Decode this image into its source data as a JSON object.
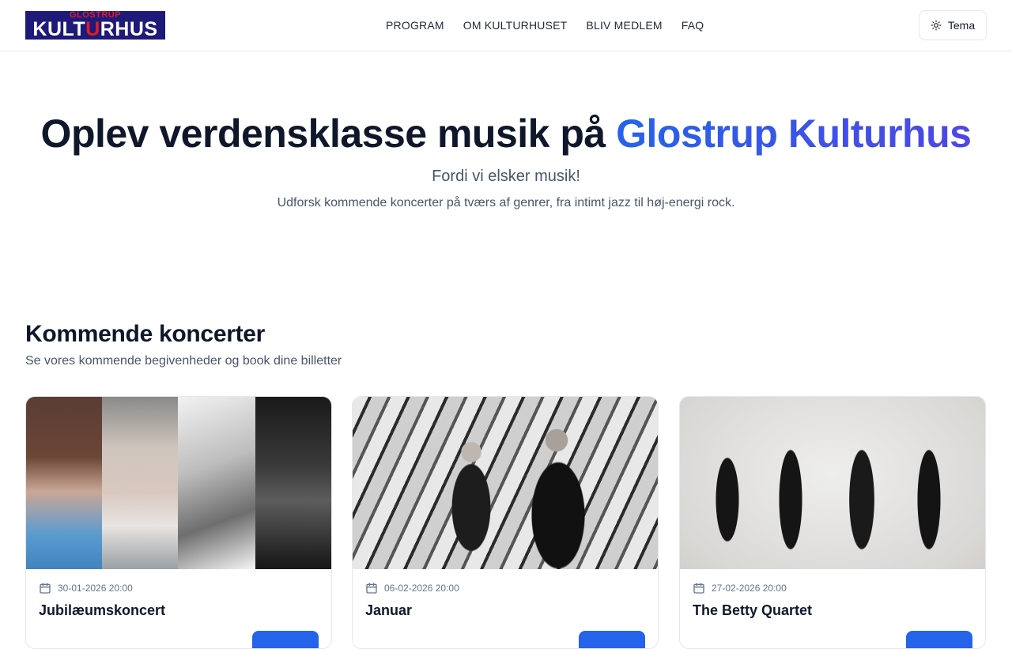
{
  "header": {
    "logo": {
      "top": "GLOSTRUP",
      "bottom_a": "KULT",
      "bottom_u": "U",
      "bottom_b": "RHUS"
    },
    "nav": [
      {
        "label": "PROGRAM"
      },
      {
        "label": "OM KULTURHUSET"
      },
      {
        "label": "BLIV MEDLEM"
      },
      {
        "label": "FAQ"
      }
    ],
    "theme_label": "Tema"
  },
  "hero": {
    "title_prefix": "Oplev verdensklasse musik på ",
    "title_accent": "Glostrup Kulturhus",
    "subtitle": "Fordi vi elsker musik!",
    "description": "Udforsk kommende koncerter på tværs af genrer, fra intimt jazz til høj-energi rock."
  },
  "section": {
    "title": "Kommende koncerter",
    "subtitle": "Se vores kommende begivenheder og book dine billetter"
  },
  "concerts": [
    {
      "date": "30-01-2026 20:00",
      "title": "Jubilæumskoncert"
    },
    {
      "date": "06-02-2026 20:00",
      "title": "Januar"
    },
    {
      "date": "27-02-2026 20:00",
      "title": "The Betty Quartet"
    }
  ],
  "colors": {
    "accent": "#2563eb",
    "accent_end": "#4f46e5",
    "logo_bg": "#1d1a7a",
    "logo_red": "#e21b23"
  }
}
